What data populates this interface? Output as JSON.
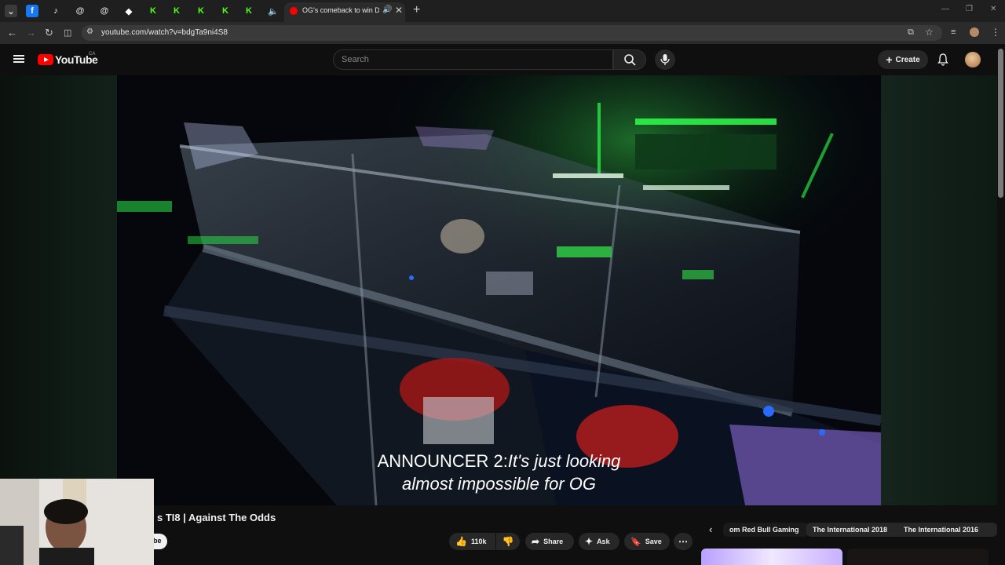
{
  "browser": {
    "tab_title": "OG's comeback to win DOTA",
    "url": "youtube.com/watch?v=bdgTa9ni4S8"
  },
  "youtube": {
    "logo_text": "YouTube",
    "country_code": "CA",
    "search_placeholder": "Search",
    "create_label": "Create"
  },
  "video": {
    "caption_speaker": "ANNOUNCER 2:",
    "caption_line1": "It's just looking",
    "caption_line2": "almost impossible for OG",
    "title_visible": "s TI8 | Against The Odds",
    "subscribe_fragment": "be"
  },
  "actions": {
    "likes": "110k",
    "share_label": "Share",
    "ask_label": "Ask",
    "save_label": "Save"
  },
  "related_chips": [
    "om Red Bull Gaming",
    "The International 2018",
    "The International 2016"
  ],
  "colors": {
    "yt_red": "#ff0000",
    "tab_bg": "#1f1f1f",
    "page_bg": "#0f0f0f"
  }
}
